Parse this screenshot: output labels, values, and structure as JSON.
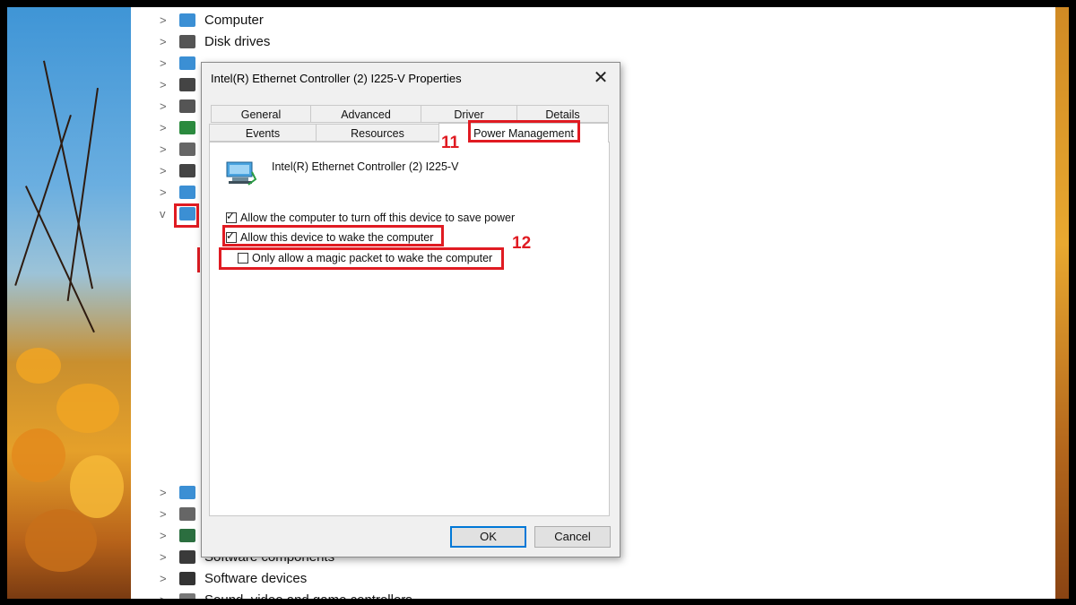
{
  "device_manager": {
    "top_items": [
      {
        "label": "Computer",
        "icon": "computer-icon",
        "chevron": ">"
      },
      {
        "label": "Disk drives",
        "icon": "disk-drive-icon",
        "chevron": ">"
      },
      {
        "label": "",
        "icon": "display-adapters-icon",
        "chevron": ">"
      },
      {
        "label": "",
        "icon": "firmware-icon",
        "chevron": ">"
      },
      {
        "label": "",
        "icon": "hid-icon",
        "chevron": ">"
      },
      {
        "label": "",
        "icon": "ide-controller-icon",
        "chevron": ">"
      },
      {
        "label": "",
        "icon": "keyboards-icon",
        "chevron": ">"
      },
      {
        "label": "",
        "icon": "mice-icon",
        "chevron": ">"
      },
      {
        "label": "",
        "icon": "monitors-icon",
        "chevron": ">"
      },
      {
        "label": "",
        "icon": "network-adapters-icon",
        "chevron": "v"
      }
    ],
    "bottom_items": [
      {
        "label": "",
        "icon": "portable-devices-icon",
        "chevron": ">"
      },
      {
        "label": "",
        "icon": "print-queues-icon",
        "chevron": ">"
      },
      {
        "label": "",
        "icon": "processors-icon",
        "chevron": ">"
      },
      {
        "label": "Software components",
        "icon": "software-components-icon",
        "chevron": ">"
      },
      {
        "label": "Software devices",
        "icon": "software-devices-icon",
        "chevron": ">"
      },
      {
        "label": "Sound, video and game controllers",
        "icon": "sound-icon",
        "chevron": ">"
      }
    ]
  },
  "dialog": {
    "title": "Intel(R) Ethernet Controller (2) I225-V Properties",
    "close_label": "✕",
    "tabs_row1": [
      "General",
      "Advanced",
      "Driver",
      "Details"
    ],
    "tabs_row2": [
      "Events",
      "Resources",
      "Power Management"
    ],
    "active_tab": "Power Management",
    "device_icon": "network-adapter-icon",
    "device_name": "Intel(R) Ethernet Controller (2) I225-V",
    "options": [
      {
        "label": "Allow the computer to turn off this device to save power",
        "checked": true
      },
      {
        "label": "Allow this device to wake the computer",
        "checked": true
      },
      {
        "label": "Only allow a magic packet to wake the computer",
        "checked": false
      }
    ],
    "ok_label": "OK",
    "cancel_label": "Cancel"
  },
  "annotations": {
    "step_11": "11",
    "step_12": "12",
    "color": "#e01b22"
  },
  "colors": {
    "window_bg": "#ffffff",
    "dialog_bg": "#f0f0f0",
    "accent": "#0078d7"
  }
}
